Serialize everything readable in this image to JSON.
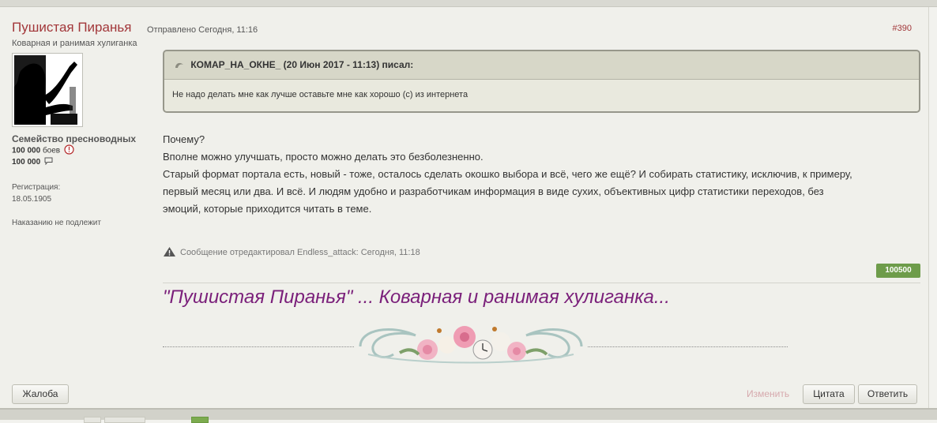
{
  "post": {
    "author": "Пушистая Пиранья",
    "user_title": "Коварная и ранимая хулиганка",
    "group": "Семейство пресноводных",
    "battles": "100 000",
    "battles_suffix": "боев",
    "messages": "100 000",
    "reg_label": "Регистрация:",
    "reg_date": "18.05.1905",
    "punishment": "Наказанию не подлежит",
    "posted": "Отправлено Сегодня, 11:16",
    "number": "#390",
    "quote": {
      "header": "КОМАР_НА_ОКНЕ_ (20 Июн 2017 - 11:13) писал:",
      "text": "Не надо делать мне как лучше оставьте мне как хорошо (с) из интернета"
    },
    "content_lines": [
      "Почему?",
      "Вполне можно улучшать, просто можно делать это безболезненно.",
      "Старый формат портала есть, новый - тоже, осталось сделать окошко выбора и всё, чего же ещё? И собирать статистику, исключив, к примеру,",
      "первый месяц или два. И всё. И людям удобно и разработчикам информация в виде сухих, объективных цифр статистики переходов, без",
      "эмоций, которые приходится читать в теме."
    ],
    "edited": "Сообщение отредактировал Endless_attack: Сегодня, 11:18",
    "reputation": "100500",
    "signature": "\"Пушистая Пиранья\" ... Коварная и ранимая хулиганка..."
  },
  "buttons": {
    "report": "Жалоба",
    "edit": "Изменить",
    "quote": "Цитата",
    "reply": "Ответить"
  },
  "colors": {
    "author": "#a2373a",
    "signature": "#7a1f7a",
    "reputation": "#6e9c4a"
  },
  "icons": [
    "info-icon",
    "message-icon",
    "quote-icon",
    "warning-icon"
  ]
}
